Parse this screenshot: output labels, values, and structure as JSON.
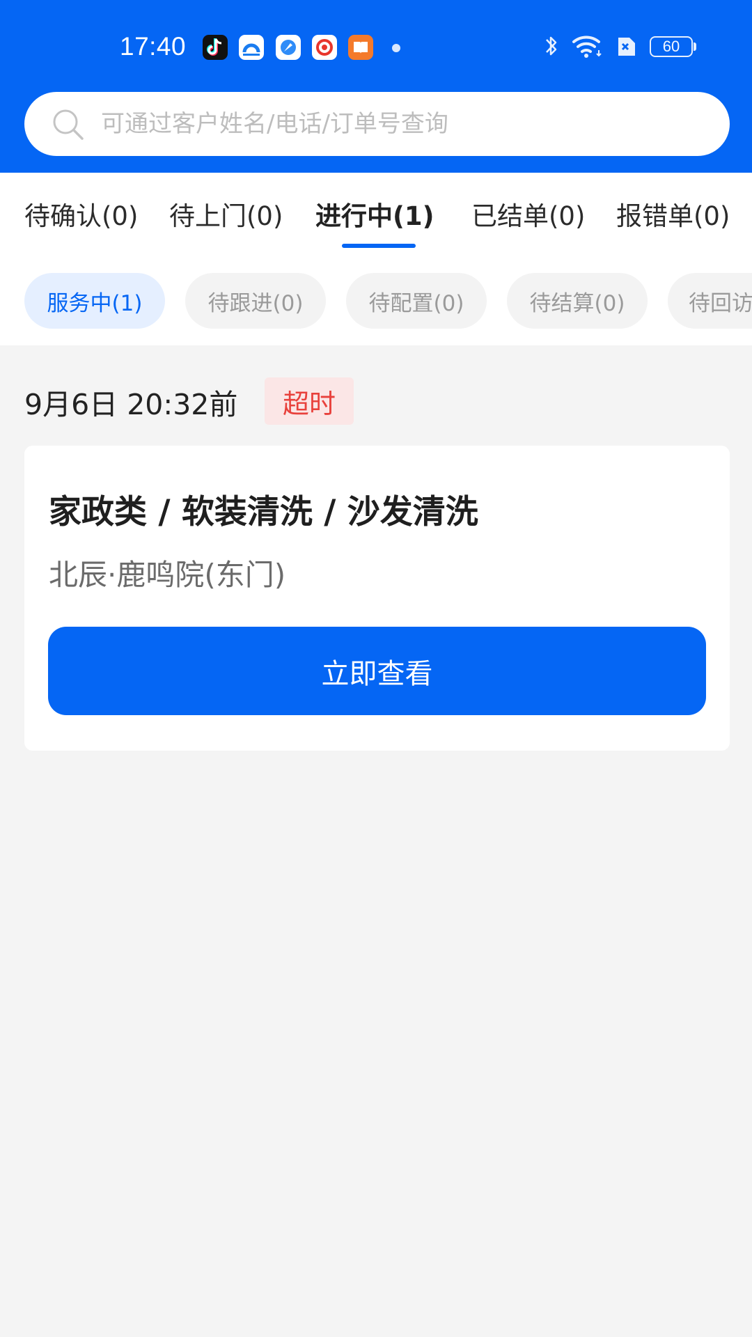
{
  "status_bar": {
    "time": "17:40",
    "battery": "60",
    "notification_icons": [
      "tiktok-icon",
      "qq-browser-icon",
      "browser-icon",
      "weibo-icon",
      "reader-icon"
    ]
  },
  "search": {
    "placeholder": "可通过客户姓名/电话/订单号查询",
    "value": ""
  },
  "main_tabs": [
    {
      "label": "待确认(0)"
    },
    {
      "label": "待上门(0)"
    },
    {
      "label": "进行中(1)",
      "active": true
    },
    {
      "label": "已结单(0)"
    },
    {
      "label": "报错单(0)"
    }
  ],
  "sub_tabs": [
    {
      "label": "服务中(1)",
      "active": true
    },
    {
      "label": "待跟进(0)"
    },
    {
      "label": "待配置(0)"
    },
    {
      "label": "待结算(0)"
    },
    {
      "label": "待回访"
    }
  ],
  "order_group": {
    "deadline": "9月6日 20:32前",
    "badge": "超时"
  },
  "order": {
    "title": "家政类 / 软装清洗 / 沙发清洗",
    "address": "北辰·鹿鸣院(东门)",
    "button_label": "立即查看"
  },
  "colors": {
    "primary": "#0566f4",
    "badge_bg": "#fbe6e6",
    "badge_text": "#e8413c",
    "page_bg": "#f4f4f4"
  }
}
